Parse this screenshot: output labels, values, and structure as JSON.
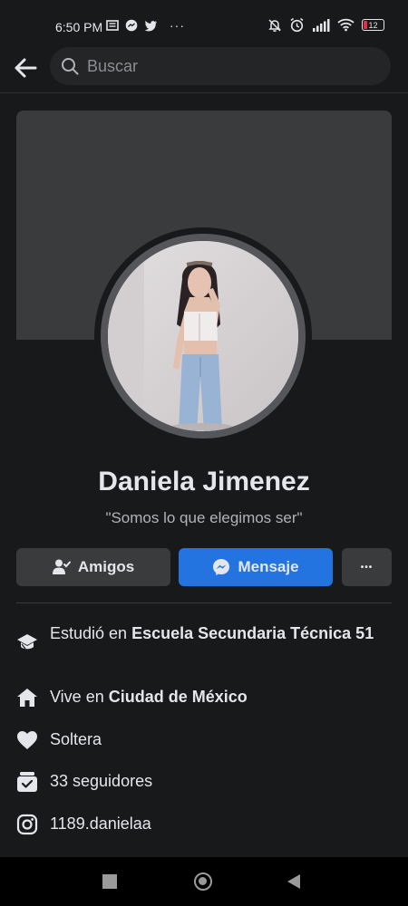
{
  "status": {
    "time": "6:50 PM",
    "battery": "12"
  },
  "search": {
    "placeholder": "Buscar"
  },
  "profile": {
    "name": "Daniela Jimenez",
    "bio": "\"Somos lo que elegimos ser\""
  },
  "actions": {
    "friends_label": "Amigos",
    "message_label": "Mensaje",
    "more_label": "•••"
  },
  "info": {
    "studied_prefix": "Estudió en ",
    "studied_place": "Escuela Secundaria Técnica 51",
    "lives_prefix": "Vive en ",
    "lives_place": "Ciudad de México",
    "relationship": "Soltera",
    "followers": "33 seguidores",
    "instagram": "1189.danielaa"
  },
  "colors": {
    "background": "#18191a",
    "accent": "#2374e1",
    "secondary_button": "#3a3b3c"
  },
  "icons": {
    "back": "arrow-left-icon",
    "search": "search-icon",
    "friends": "friend-check-icon",
    "messenger": "messenger-icon",
    "education": "graduation-cap-icon",
    "home": "home-icon",
    "heart": "heart-icon",
    "followers": "followers-icon",
    "instagram": "instagram-icon"
  }
}
